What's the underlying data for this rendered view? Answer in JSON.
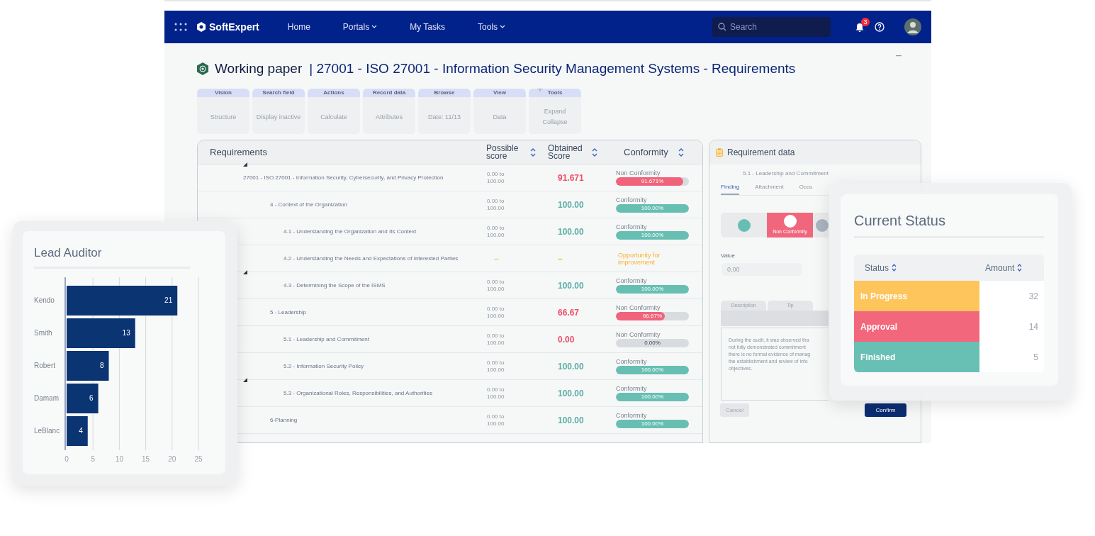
{
  "navbar": {
    "brand": "SoftExpert",
    "links": [
      {
        "label": "Home",
        "dropdown": false
      },
      {
        "label": "Portals",
        "dropdown": true
      },
      {
        "label": "My Tasks",
        "dropdown": false
      },
      {
        "label": "Tools",
        "dropdown": true
      }
    ],
    "search": {
      "placeholder": "Search"
    },
    "notification_count": "3"
  },
  "page_title": {
    "title": "Working paper",
    "subtitle": "| 27001 - ISO 27001 - Information Security Management Systems - Requirements"
  },
  "toolbar": [
    {
      "label": "Vision",
      "items": [
        "Structure"
      ],
      "add": false
    },
    {
      "label": "Search field",
      "items": [
        "Display inactive"
      ],
      "add": false
    },
    {
      "label": "Actions",
      "items": [
        "Calculate"
      ],
      "add": false
    },
    {
      "label": "Record data",
      "items": [
        "Attributes"
      ],
      "add": false
    },
    {
      "label": "Browse",
      "items": [
        "Date: 11/13"
      ],
      "add": false
    },
    {
      "label": "View",
      "items": [
        "Data"
      ],
      "add": false
    },
    {
      "label": "Tools",
      "items": [
        "Expand",
        "Collapse"
      ],
      "add": true
    }
  ],
  "table": {
    "columns": [
      "Requirements",
      "Possible score",
      "Obtained Score",
      "Conformity"
    ],
    "rows": [
      {
        "label": "27001 - ISO 27001 - Information Security, Cybersecurity, and Privacy Protection",
        "caret": true,
        "possible": "0.00 to 100.00",
        "obtained": "91.671",
        "conformity": {
          "kind": "non_conformity",
          "label": "Non Conformity",
          "level": 0.92,
          "reading": "91.671%"
        },
        "children": [
          {
            "label": "4 - Context of the Organization",
            "caret": false,
            "possible": "0.00 to 100.00",
            "obtained": "100.00",
            "conformity": {
              "kind": "conformity",
              "label": "Conformity",
              "level": 1,
              "reading": "100.00%"
            },
            "children": [
              {
                "label": "4.1 - Understanding the Organization and Its Context",
                "caret": false,
                "possible": "0.00 to 100.00",
                "obtained": "100.00",
                "conformity": {
                  "kind": "conformity",
                  "label": "Conformity",
                  "level": 1,
                  "reading": "100.00%"
                }
              },
              {
                "label": "4.2 - Understanding the Needs and Expectations of Interested Parties",
                "caret": false,
                "possible": "–",
                "obtained": "–",
                "conformity": {
                  "kind": "opportunity",
                  "label": "Opportunity for improvement"
                }
              },
              {
                "label": "4.3 - Determining the Scope of the ISMS",
                "caret": true,
                "possible": "0.00 to 100.00",
                "obtained": "100.00",
                "conformity": {
                  "kind": "conformity",
                  "label": "Conformity",
                  "level": 1,
                  "reading": "100.00%"
                }
              }
            ]
          },
          {
            "label": "5 - Leadership",
            "caret": false,
            "possible": "0.00 to 100.00",
            "obtained": "66.67",
            "conformity": {
              "kind": "non_conformity",
              "label": "Non Conformity",
              "level": 0.67,
              "reading": "66.67%"
            },
            "children": [
              {
                "label": "5.1 - Leadership and Commitment",
                "caret": false,
                "possible": "0.00 to 100.00",
                "obtained": "0.00",
                "conformity": {
                  "kind": "non_conformity",
                  "label": "Non Conformity",
                  "level": 0,
                  "reading": "0.00%"
                }
              },
              {
                "label": "5.2 - Information Security Policy",
                "caret": false,
                "possible": "0.00 to 100.00",
                "obtained": "100.00",
                "conformity": {
                  "kind": "conformity",
                  "label": "Conformity",
                  "level": 1,
                  "reading": "100.00%"
                }
              },
              {
                "label": "5.3 - Organizational Roles, Responsibilities, and Authorities",
                "caret": true,
                "possible": "0.00 to 100.00",
                "obtained": "100.00",
                "conformity": {
                  "kind": "conformity",
                  "label": "Conformity",
                  "level": 1,
                  "reading": "100.00%"
                }
              }
            ]
          },
          {
            "label": "6-Planning",
            "caret": false,
            "possible": "0.00 to 100.00",
            "obtained": "100.00",
            "conformity": {
              "kind": "conformity",
              "label": "Conformity",
              "level": 1,
              "reading": "100.00%"
            }
          }
        ]
      }
    ]
  },
  "requirement_panel": {
    "title": "Requirement data",
    "subtitle": "5.1 - Leadership and Commitment",
    "tabs": [
      {
        "label": "Finding",
        "selected": true
      },
      {
        "label": "Attachment",
        "selected": false
      },
      {
        "label": "Occu",
        "selected": false
      }
    ],
    "status_options": [
      {
        "color": "#67bfb3",
        "selected": false
      },
      {
        "color": "#f0677d",
        "label": "Non Conformity",
        "selected": true
      },
      {
        "color": "#a9b4be",
        "selected": false
      }
    ],
    "value_label": "Value",
    "value": "0,00",
    "subtabs": [
      "Description",
      "Tip"
    ],
    "description_lines": [
      "During the audit, it was observed tha",
      "not fully demonstrated commitment",
      "there is no formal evidence of manag",
      "the establishment and review of info",
      "objectives."
    ],
    "buttons": [
      {
        "label": "Cancel",
        "disabled": true
      },
      {
        "label": "Confirm",
        "disabled": false
      }
    ]
  },
  "lead_auditor": {
    "chart_data": {
      "type": "bar",
      "orientation": "horizontal",
      "title": "Lead Auditor",
      "categories": [
        "Kendo",
        "Smith",
        "Robert",
        "Damam",
        "LeBlanc"
      ],
      "values": [
        21,
        13,
        8,
        6,
        4
      ],
      "xlim": [
        0,
        25
      ],
      "xticks": [
        0,
        5,
        10,
        15,
        20,
        25
      ],
      "grid": true,
      "data_labels": true
    }
  },
  "current_status": {
    "title": "Current Status",
    "columns": [
      "Status",
      "Amount"
    ],
    "rows": [
      {
        "status": "In Progress",
        "amount": "32",
        "color": "#fec55c"
      },
      {
        "status": "Approval",
        "amount": "14",
        "color": "#f2677c"
      },
      {
        "status": "Finished",
        "amount": "5",
        "color": "#68bfb3"
      }
    ]
  }
}
